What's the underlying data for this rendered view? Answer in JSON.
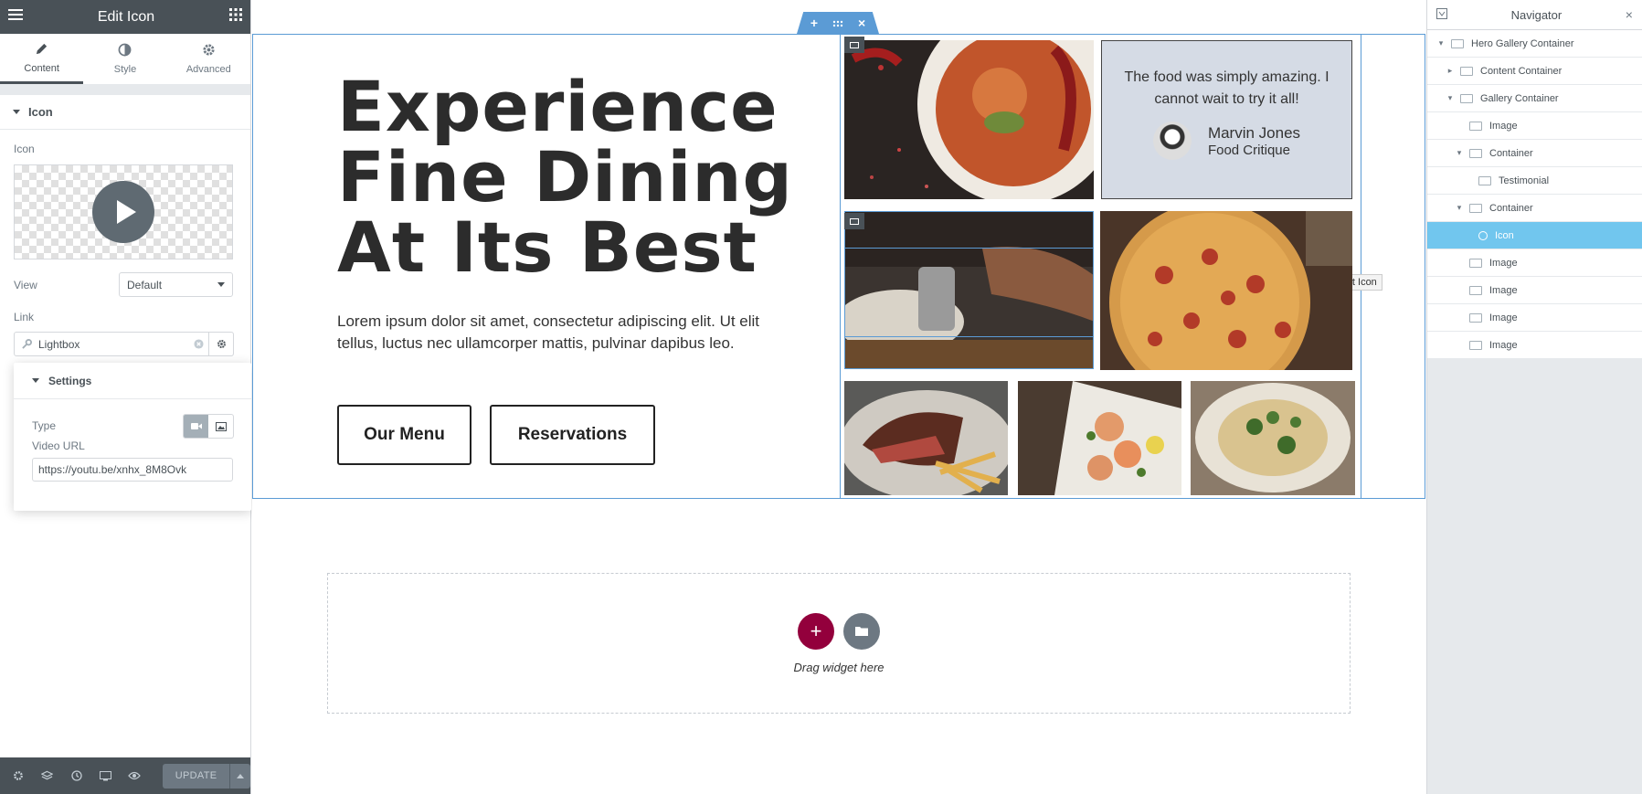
{
  "panel": {
    "title": "Edit Icon",
    "tabs": [
      {
        "label": "Content",
        "icon": "pencil-icon"
      },
      {
        "label": "Style",
        "icon": "half-circle-icon"
      },
      {
        "label": "Advanced",
        "icon": "gear-icon"
      }
    ],
    "section_title": "Icon",
    "icon_label": "Icon",
    "view_label": "View",
    "view_value": "Default",
    "link_label": "Link",
    "link_value": "Lightbox",
    "settings_title": "Settings",
    "type_label": "Type",
    "video_url_label": "Video URL",
    "video_url_value": "https://youtu.be/xnhx_8M8Ovk",
    "update_label": "UPDATE"
  },
  "canvas": {
    "hero_title": [
      "Experience",
      "Fine Dining",
      "At Its Best"
    ],
    "hero_text": "Lorem ipsum dolor sit amet, consectetur adipiscing elit. Ut elit tellus, luctus nec ullamcorper mattis, pulvinar dapibus leo.",
    "buttons": {
      "menu": "Our Menu",
      "reservations": "Reservations"
    },
    "testimonial": {
      "quote": "The food was simply amazing. I cannot wait to try it all!",
      "name": "Marvin Jones",
      "role": "Food Critique"
    },
    "edit_tooltip": "Edit Icon",
    "drop_zone_text": "Drag widget here",
    "colors": {
      "accent": "#5b9bd5",
      "add_button": "#93003c",
      "selected": "#71c6ee"
    }
  },
  "navigator": {
    "title": "Navigator",
    "items": [
      {
        "label": "Hero Gallery Container",
        "level": 0,
        "toggle": "▾"
      },
      {
        "label": "Content Container",
        "level": 1,
        "toggle": "▸"
      },
      {
        "label": "Gallery Container",
        "level": 1,
        "toggle": "▾"
      },
      {
        "label": "Image",
        "level": 2,
        "toggle": ""
      },
      {
        "label": "Container",
        "level": 2,
        "toggle": "▾"
      },
      {
        "label": "Testimonial",
        "level": 3,
        "toggle": ""
      },
      {
        "label": "Container",
        "level": 2,
        "toggle": "▾"
      },
      {
        "label": "Icon",
        "level": 3,
        "toggle": "",
        "selected": true
      },
      {
        "label": "Image",
        "level": 2,
        "toggle": ""
      },
      {
        "label": "Image",
        "level": 2,
        "toggle": ""
      },
      {
        "label": "Image",
        "level": 2,
        "toggle": ""
      },
      {
        "label": "Image",
        "level": 2,
        "toggle": ""
      }
    ]
  }
}
